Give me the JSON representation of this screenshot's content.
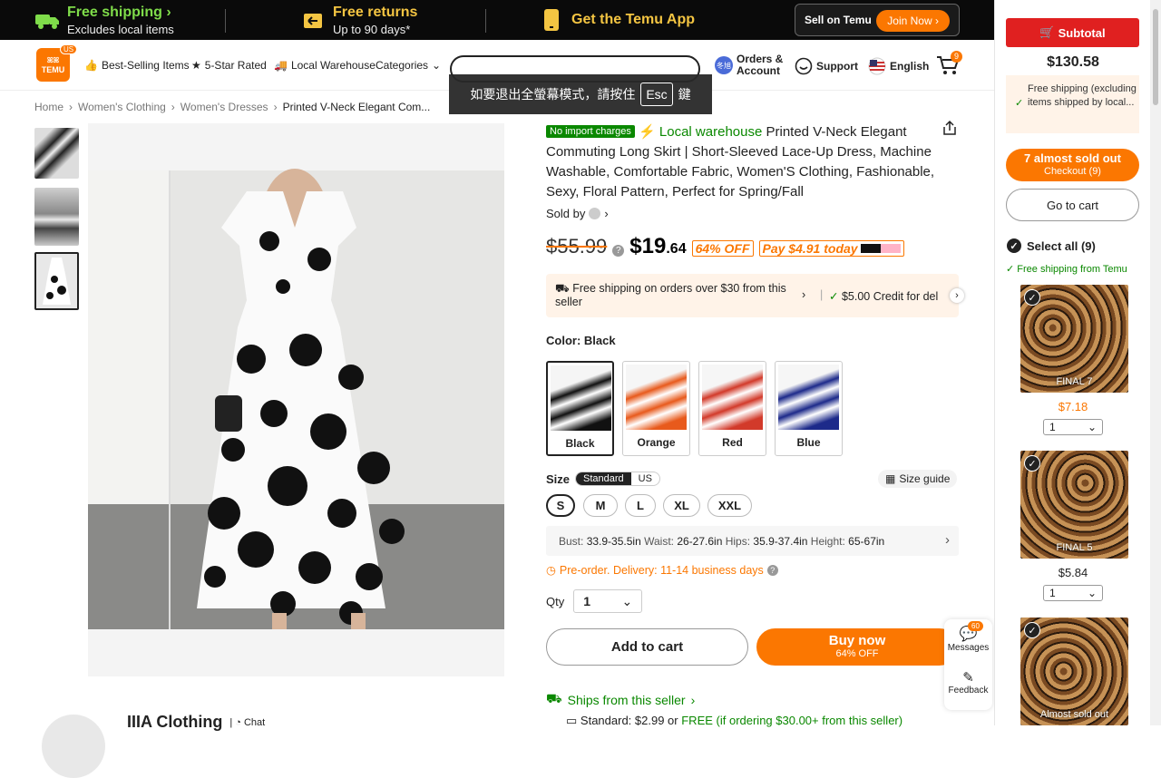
{
  "banner": {
    "free_shipping": "Free shipping",
    "free_shipping_sub": "Excludes local items",
    "free_returns": "Free returns",
    "free_returns_sub": "Up to 90 days*",
    "app": "Get the Temu App",
    "sell": "Sell on Temu",
    "join": "Join Now"
  },
  "header": {
    "logo_line1": "TEMU",
    "logo_badge": "US",
    "nav": [
      "Best-Selling Items",
      "5-Star Rated",
      "Local Warehouse",
      "Categories"
    ],
    "orders": "Orders &",
    "account": "Account",
    "support": "Support",
    "language": "English",
    "cart_count": "9",
    "toast_text": "如要退出全螢幕模式，請按住",
    "toast_key": "Esc",
    "toast_end": "鍵"
  },
  "breadcrumb": [
    "Home",
    "Women's Clothing",
    "Women's Dresses",
    "Printed V-Neck Elegant Com..."
  ],
  "product": {
    "badge": "No import charges",
    "local": "Local warehouse",
    "title": "Printed V-Neck Elegant Commuting Long Skirt | Short-Sleeved Lace-Up Dress, Machine Washable, Comfortable Fabric, Women'S Clothing, Fashionable, Sexy, Floral Pattern, Perfect for Spring/Fall",
    "sold_by": "Sold by",
    "old_price": "$55.99",
    "price_main": "$19",
    "price_cents": ".64",
    "discount": "64% OFF",
    "pay": "Pay $4.91 today",
    "ship_text": "Free shipping on orders over $30 from this seller",
    "credit_text": "$5.00 Credit for del",
    "color_label": "Color: Black",
    "colors": [
      "Black",
      "Orange",
      "Red",
      "Blue"
    ],
    "size_label": "Size",
    "size_std": "Standard",
    "size_us": "US",
    "size_guide": "Size guide",
    "sizes": [
      "S",
      "M",
      "L",
      "XL",
      "XXL"
    ],
    "bust_lbl": "Bust:",
    "bust": "33.9-35.5in",
    "waist_lbl": "Waist:",
    "waist": "26-27.6in",
    "hips_lbl": "Hips:",
    "hips": "35.9-37.4in",
    "height_lbl": "Height:",
    "height": "65-67in",
    "preorder": "Pre-order. Delivery: 11-14 business days",
    "qty_label": "Qty",
    "qty": "1",
    "add_cart": "Add to cart",
    "buy_now": "Buy now",
    "buy_off": "64% OFF",
    "ships_from": "Ships from this seller",
    "std_ship": "Standard: $2.99 or ",
    "std_free": "FREE (if ordering $30.00+ from this seller)",
    "seller_name": "IIIA Clothing",
    "chat": "Chat"
  },
  "floating": {
    "messages": "Messages",
    "msg_count": "60",
    "feedback": "Feedback"
  },
  "sidebar": {
    "subtotal_btn": "Subtotal",
    "subtotal": "$130.58",
    "free_ship": "Free shipping (excluding items shipped by local...",
    "almost": "7 almost sold out",
    "checkout": "Checkout (9)",
    "go_cart": "Go to cart",
    "select_all": "Select all (9)",
    "free_from": "Free shipping from Temu",
    "items": [
      {
        "label": "FINAL 7",
        "price": "$7.18",
        "qty": "1"
      },
      {
        "label": "FINAL 5",
        "price": "$5.84",
        "qty": "1"
      },
      {
        "label": "Almost sold out"
      }
    ]
  },
  "colors": {
    "accent": "#fb7701",
    "green": "#0a8800",
    "red": "#e02020"
  }
}
